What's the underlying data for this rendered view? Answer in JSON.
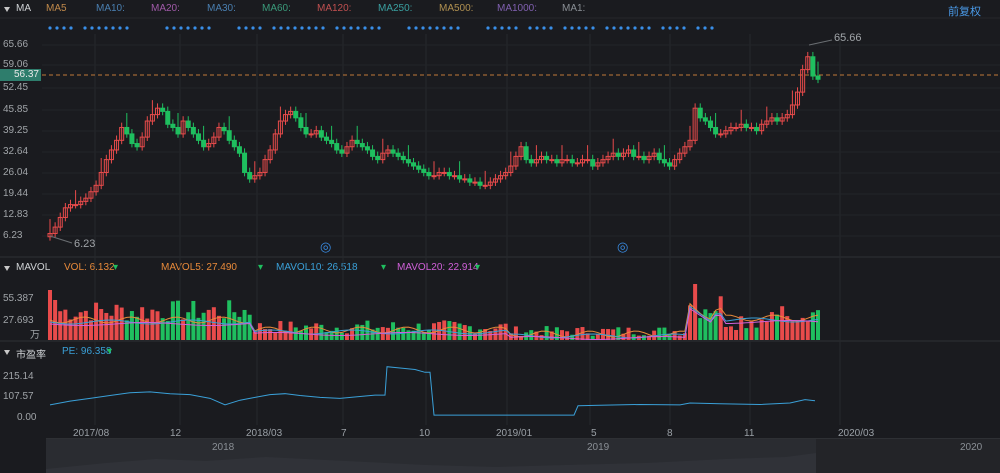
{
  "price_panel": {
    "title": "MA",
    "ma_labels": [
      {
        "text": "MA5",
        "color": "#c0894a"
      },
      {
        "text": "MA10:",
        "color": "#4a7fb0"
      },
      {
        "text": "MA20:",
        "color": "#a05aa8"
      },
      {
        "text": "MA30:",
        "color": "#4a7fb0"
      },
      {
        "text": "MA60:",
        "color": "#3a9a7a"
      },
      {
        "text": "MA120:",
        "color": "#c05050"
      },
      {
        "text": "MA250:",
        "color": "#3aa0a0"
      },
      {
        "text": "MA500:",
        "color": "#b09050"
      },
      {
        "text": "MA1000:",
        "color": "#8060b0"
      },
      {
        "text": "MA1:",
        "color": "#8a8f95"
      }
    ],
    "adjust_button": "前复权",
    "y_ticks": [
      "65.66",
      "59.06",
      "52.45",
      "45.85",
      "39.25",
      "32.64",
      "26.04",
      "19.44",
      "12.83",
      "6.23"
    ],
    "current_price": "56.37",
    "high_label": "65.66",
    "low_label": "6.23"
  },
  "volume_panel": {
    "title": "MAVOL",
    "vol": "VOL: 6.132",
    "mavol5": "MAVOL5: 27.490",
    "mavol10": "MAVOL10: 26.518",
    "mavol20": "MAVOL20: 22.914",
    "y_ticks": [
      "55.387",
      "27.693"
    ],
    "unit": "万"
  },
  "pe_panel": {
    "title": "市盈率",
    "pe": "PE: 96.358",
    "y_ticks": [
      "215.14",
      "107.57",
      "0.00"
    ]
  },
  "x_axis": [
    "2017/08",
    "12",
    "2018/03",
    "7",
    "10",
    "2019/01",
    "5",
    "8",
    "11",
    "2020/03"
  ],
  "navigator": [
    "2018",
    "2019",
    "2020"
  ],
  "colors": {
    "up": "#e84b4b",
    "down": "#1fbf5f",
    "pe_line": "#3aa0d8",
    "ma_blue": "#3a8fe8"
  }
}
